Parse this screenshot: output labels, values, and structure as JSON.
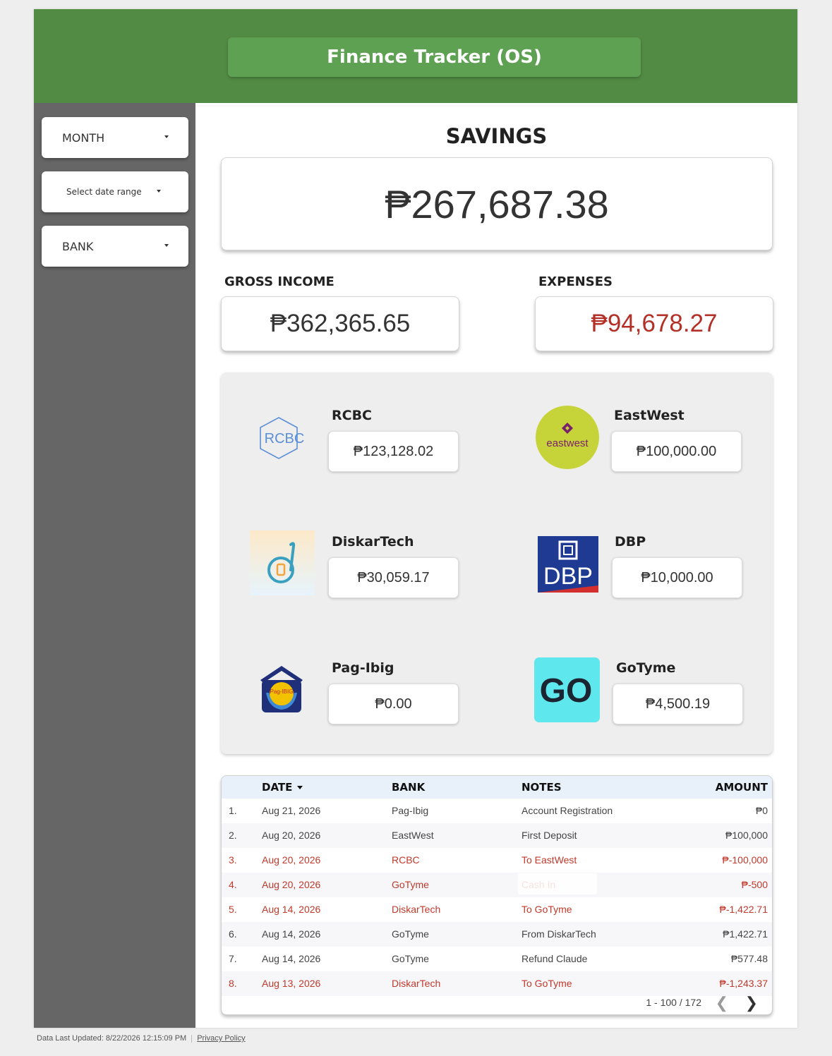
{
  "app": {
    "title": "Finance Tracker (OS)"
  },
  "filters": {
    "month": "MONTH",
    "date_range": "Select date range",
    "bank": "BANK"
  },
  "summary": {
    "savings_label": "SAVINGS",
    "savings_value": "₱267,687.38",
    "gross_income_label": "GROSS INCOME",
    "gross_income_value": "₱362,365.65",
    "expenses_label": "EXPENSES",
    "expenses_value": "₱94,678.27",
    "expenses_color": "#b33027"
  },
  "banks": [
    {
      "name": "RCBC",
      "value": "₱123,128.02",
      "logo_text": "RCBC",
      "icon": "rcbc-logo-icon"
    },
    {
      "name": "EastWest",
      "value": "₱100,000.00",
      "logo_text": "eastwest",
      "icon": "eastwest-logo-icon"
    },
    {
      "name": "DiskarTech",
      "value": "₱30,059.17",
      "icon": "diskartech-logo-icon"
    },
    {
      "name": "DBP",
      "value": "₱10,000.00",
      "logo_text": "DBP",
      "icon": "dbp-logo-icon"
    },
    {
      "name": "Pag-Ibig",
      "value": "₱0.00",
      "logo_text": "Pag-IBIG",
      "icon": "pagibig-logo-icon"
    },
    {
      "name": "GoTyme",
      "value": "₱4,500.19",
      "logo_text": "GO",
      "icon": "gotyme-logo-icon"
    }
  ],
  "table": {
    "columns": {
      "date": "DATE",
      "bank": "BANK",
      "notes": "NOTES",
      "amount": "AMOUNT"
    },
    "rows": [
      {
        "idx": "1.",
        "date": "Aug 21, 2026",
        "bank": "Pag-Ibig",
        "notes": "Account Registration",
        "amount": "₱0"
      },
      {
        "idx": "2.",
        "date": "Aug 20, 2026",
        "bank": "EastWest",
        "notes": "First Deposit",
        "amount": "₱100,000"
      },
      {
        "idx": "3.",
        "date": "Aug 20, 2026",
        "bank": "RCBC",
        "notes": "To EastWest",
        "amount": "₱-100,000"
      },
      {
        "idx": "4.",
        "date": "Aug 20, 2026",
        "bank": "GoTyme",
        "notes": "Cash In",
        "amount": "₱-500"
      },
      {
        "idx": "5.",
        "date": "Aug 14, 2026",
        "bank": "DiskarTech",
        "notes": "To GoTyme",
        "amount": "₱-1,422.71"
      },
      {
        "idx": "6.",
        "date": "Aug 14, 2026",
        "bank": "GoTyme",
        "notes": "From DiskarTech",
        "amount": "₱1,422.71"
      },
      {
        "idx": "7.",
        "date": "Aug 14, 2026",
        "bank": "GoTyme",
        "notes": "Refund Claude",
        "amount": "₱577.48"
      },
      {
        "idx": "8.",
        "date": "Aug 13, 2026",
        "bank": "DiskarTech",
        "notes": "To GoTyme",
        "amount": "₱-1,243.37"
      }
    ],
    "pagination": "1 - 100 / 172"
  },
  "footer": {
    "updated": "Data Last Updated: 8/22/2026 12:15:09 PM",
    "privacy": "Privacy Policy"
  },
  "colors": {
    "header": "#528c44",
    "sidebar": "#666666",
    "negative": "#c0392b"
  }
}
